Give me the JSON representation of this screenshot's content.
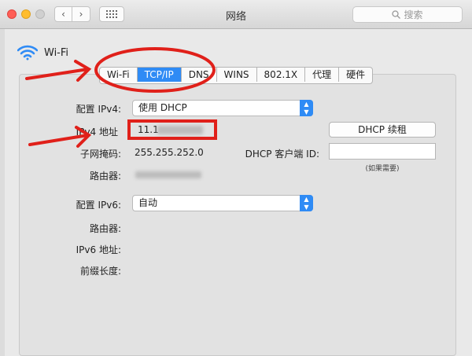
{
  "window": {
    "title": "网络",
    "search_placeholder": "搜索",
    "nav": {
      "back": "‹",
      "forward": "›"
    }
  },
  "service": {
    "name": "Wi-Fi"
  },
  "tabs": [
    {
      "label": "Wi-Fi",
      "active": false
    },
    {
      "label": "TCP/IP",
      "active": true
    },
    {
      "label": "DNS",
      "active": false
    },
    {
      "label": "WINS",
      "active": false
    },
    {
      "label": "802.1X",
      "active": false
    },
    {
      "label": "代理",
      "active": false
    },
    {
      "label": "硬件",
      "active": false
    }
  ],
  "ipv4": {
    "config_label": "配置 IPv4:",
    "config_value": "使用 DHCP",
    "address_label": "IPv4 地址",
    "address_value": "11.1",
    "subnet_label": "子网掩码:",
    "subnet_value": "255.255.252.0",
    "router_label": "路由器:"
  },
  "dhcp": {
    "renew_button": "DHCP 续租",
    "client_id_label": "DHCP 客户端 ID:",
    "client_id_value": "",
    "client_id_hint": "(如果需要)"
  },
  "ipv6": {
    "config_label": "配置 IPv6:",
    "config_value": "自动",
    "router_label": "路由器:",
    "address_label": "IPv6 地址:",
    "prefix_label": "前缀长度:"
  },
  "colors": {
    "accent": "#2f8bf5",
    "annotation": "#e0201a"
  }
}
